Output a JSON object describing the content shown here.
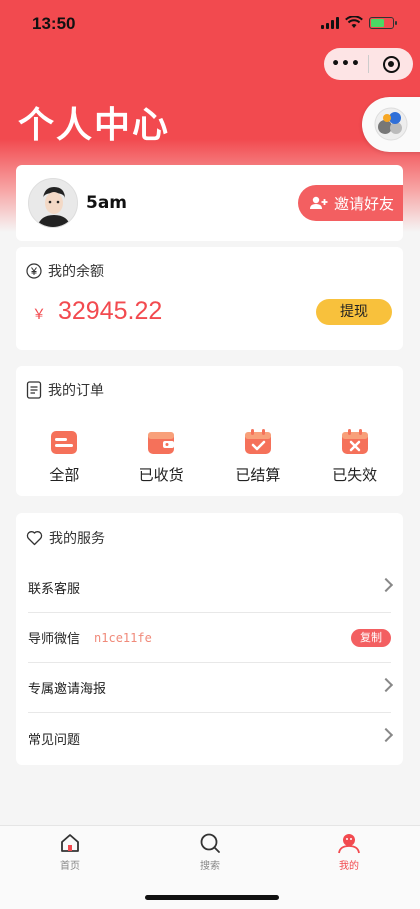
{
  "status_bar": {
    "time": "13:50"
  },
  "header": {
    "title": "个人中心"
  },
  "capsule": {
    "more_glyph": "•••",
    "icons": [
      "more-icon",
      "close-target-icon"
    ]
  },
  "profile": {
    "username": "5am",
    "invite_label": "邀请好友"
  },
  "balance": {
    "title": "我的余额",
    "currency": "￥",
    "amount": "32945.22",
    "withdraw_label": "提现"
  },
  "orders": {
    "title": "我的订单",
    "items": [
      {
        "label": "全部",
        "icon": "all-orders-icon"
      },
      {
        "label": "已收货",
        "icon": "received-icon"
      },
      {
        "label": "已结算",
        "icon": "settled-icon"
      },
      {
        "label": "已失效",
        "icon": "expired-icon"
      }
    ]
  },
  "services": {
    "title": "我的服务",
    "items": [
      {
        "label": "联系客服"
      },
      {
        "label": "导师微信",
        "value": "n1ce11fe",
        "action": "复制"
      },
      {
        "label": "专属邀请海报"
      },
      {
        "label": "常见问题"
      }
    ]
  },
  "tabbar": {
    "items": [
      {
        "label": "首页",
        "icon": "home-icon"
      },
      {
        "label": "搜索",
        "icon": "search-icon"
      },
      {
        "label": "我的",
        "icon": "profile-icon",
        "active": true
      }
    ]
  },
  "colors": {
    "brand": "#f24a4f",
    "accent_yellow": "#f8c13c",
    "badge": "#f35f61"
  }
}
